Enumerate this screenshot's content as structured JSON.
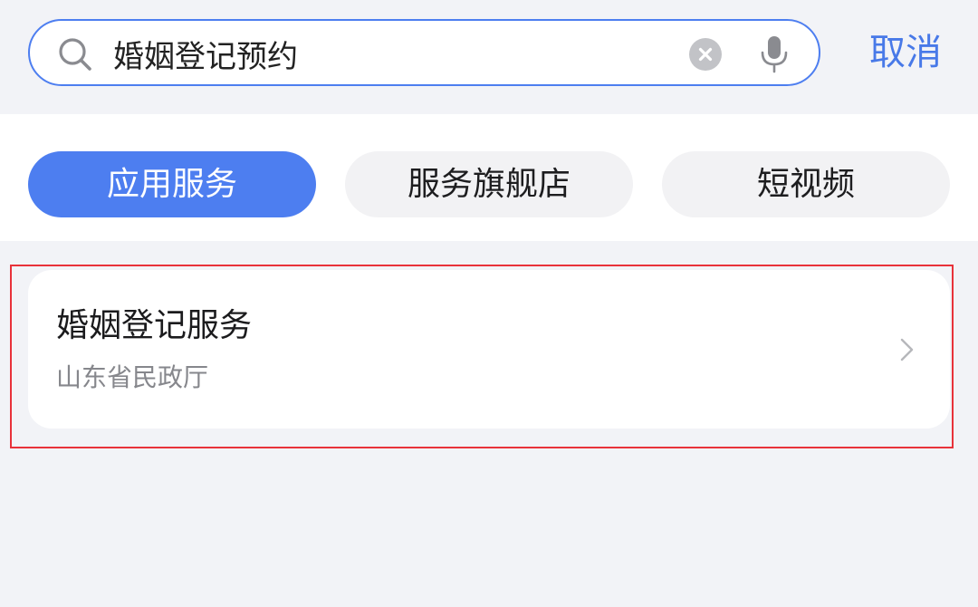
{
  "search": {
    "query": "婚姻登记预约",
    "icon": "search-icon",
    "clear_icon": "clear-icon",
    "voice_icon": "microphone-icon",
    "accent_color": "#4d7ef0"
  },
  "header": {
    "cancel_label": "取消",
    "cancel_color": "#4879e8"
  },
  "tabs": [
    {
      "label": "应用服务",
      "active": true
    },
    {
      "label": "服务旗舰店",
      "active": false
    },
    {
      "label": "短视频",
      "active": false
    }
  ],
  "results": [
    {
      "title": "婚姻登记服务",
      "subtitle": "山东省民政厅",
      "icon": "chevron-right-icon"
    }
  ],
  "highlight_color": "#e8323a"
}
